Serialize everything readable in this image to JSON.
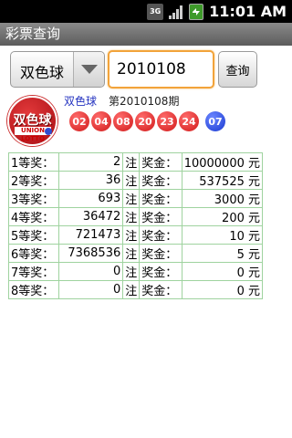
{
  "status_bar": {
    "network_type": "3G",
    "signal_icon": "signal-icon",
    "battery_icon": "battery-icon",
    "time": "11:01",
    "ampm": "AM"
  },
  "title_bar": {
    "title": "彩票查询"
  },
  "toolbar": {
    "lottery_type": "双色球",
    "issue_value": "2010108",
    "query_label": "查询"
  },
  "result": {
    "logo_text": "双色球",
    "logo_sub": "UNION LOTTO",
    "lottery_name": "双色球",
    "issue_label": "第2010108期",
    "red_balls": [
      "02",
      "04",
      "08",
      "20",
      "23",
      "24"
    ],
    "blue_ball": "07",
    "red_color": "#d11a1a",
    "blue_color": "#1a3ad1"
  },
  "prizes": [
    {
      "level": "1等奖：",
      "count": "2",
      "unit": "注",
      "amount_label": "奖金：",
      "amount": "10000000 元"
    },
    {
      "level": "2等奖：",
      "count": "36",
      "unit": "注",
      "amount_label": "奖金：",
      "amount": "537525 元"
    },
    {
      "level": "3等奖：",
      "count": "693",
      "unit": "注",
      "amount_label": "奖金：",
      "amount": "3000 元"
    },
    {
      "level": "4等奖：",
      "count": "36472",
      "unit": "注",
      "amount_label": "奖金：",
      "amount": "200 元"
    },
    {
      "level": "5等奖：",
      "count": "721473",
      "unit": "注",
      "amount_label": "奖金：",
      "amount": "10 元"
    },
    {
      "level": "6等奖：",
      "count": "7368536",
      "unit": "注",
      "amount_label": "奖金：",
      "amount": "5 元"
    },
    {
      "level": "7等奖：",
      "count": "0",
      "unit": "注",
      "amount_label": "奖金：",
      "amount": "0 元"
    },
    {
      "level": "8等奖：",
      "count": "0",
      "unit": "注",
      "amount_label": "奖金：",
      "amount": "0 元"
    }
  ]
}
